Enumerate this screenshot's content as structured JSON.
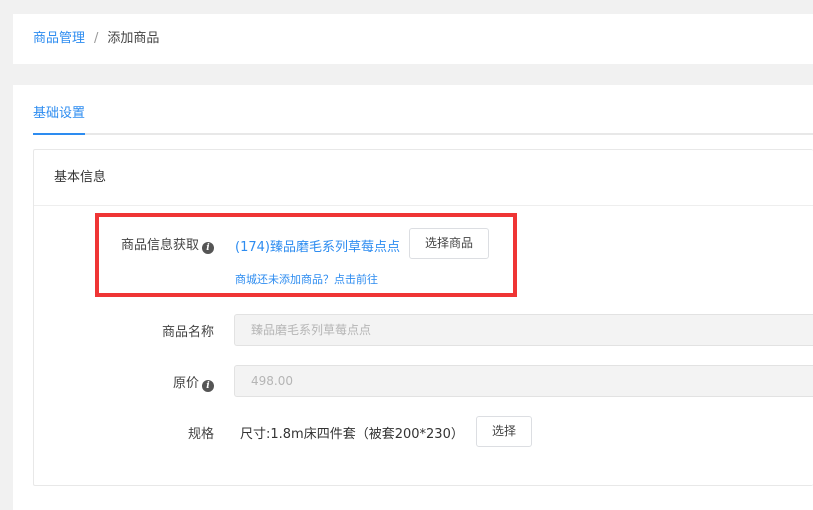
{
  "breadcrumb": {
    "parent": "商品管理",
    "separator": "/",
    "current": "添加商品"
  },
  "tabs": {
    "active": "基础设置"
  },
  "panel": {
    "title": "基本信息"
  },
  "form": {
    "product_source": {
      "label": "商品信息获取",
      "selected": "(174)臻品磨毛系列草莓点点",
      "button": "选择商品",
      "link": "商城还未添加商品？点击前往"
    },
    "product_name": {
      "label": "商品名称",
      "value": "臻品磨毛系列草莓点点"
    },
    "original_price": {
      "label": "原价",
      "value": "498.00"
    },
    "spec": {
      "label": "规格",
      "value": "尺寸:1.8m床四件套（被套200*230）",
      "button": "选择"
    }
  },
  "colors": {
    "accent": "#2d8cf0",
    "highlight": "#ef3535"
  },
  "icons": {
    "info": "info-icon"
  }
}
